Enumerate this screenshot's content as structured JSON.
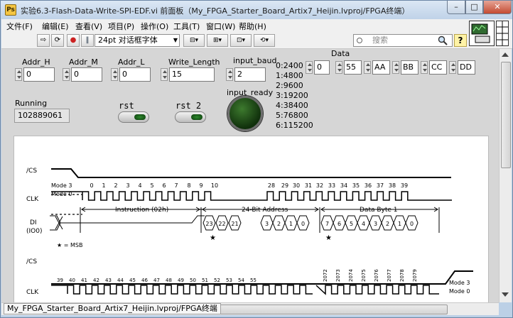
{
  "window": {
    "title": "实验6.3-Flash-Data-Write-SPI-EDF.vi 前面板（My_FPGA_Starter_Board_Artix7_Heijin.lvproj/FPGA终端）",
    "minimize": "–",
    "maximize": "□",
    "close": "✕"
  },
  "menu": [
    {
      "label": "文件(F)"
    },
    {
      "label": "编辑(E)"
    },
    {
      "label": "查看(V)"
    },
    {
      "label": "项目(P)"
    },
    {
      "label": "操作(O)"
    },
    {
      "label": "工具(T)"
    },
    {
      "label": "窗口(W)"
    },
    {
      "label": "帮助(H)"
    }
  ],
  "toolbar": {
    "font": "24pt 对话框字体",
    "search_placeholder": "搜索",
    "help": "?"
  },
  "controls": {
    "addr_h": {
      "label": "Addr_H",
      "value": "0"
    },
    "addr_m": {
      "label": "Addr_M",
      "value": "0"
    },
    "addr_l": {
      "label": "Addr_L",
      "value": "0"
    },
    "write_length": {
      "label": "Write_Length",
      "value": "15"
    },
    "input_baud": {
      "label": "input_baud",
      "value": "2"
    },
    "baud_options": [
      "0:2400",
      "1:4800",
      "2:9600",
      "3:19200",
      "4:38400",
      "5:76800",
      "6:115200"
    ],
    "data": {
      "label": "Data",
      "index": "0",
      "values": [
        "55",
        "AA",
        "BB",
        "CC",
        "DD"
      ]
    },
    "running": {
      "label": "Running",
      "value": "102889061"
    },
    "rst": {
      "label": "rst"
    },
    "rst2": {
      "label": "rst 2"
    },
    "input_ready": {
      "label": "input_ready"
    }
  },
  "timing": {
    "cs": "/CS",
    "clk": "CLK",
    "di": "DI",
    "io0": "(IO0)",
    "mode3": "Mode 3",
    "mode0": "Mode 0",
    "top_clk_nums": [
      "0",
      "1",
      "2",
      "3",
      "4",
      "5",
      "6",
      "7",
      "8",
      "9",
      "10",
      "28",
      "29",
      "30",
      "31",
      "32",
      "33",
      "34",
      "35",
      "36",
      "37",
      "38",
      "39"
    ],
    "instruction": "Instruction (02h)",
    "address": "24-Bit Address",
    "data_byte": "Data Byte 1",
    "addr_bits": [
      "23",
      "22",
      "21",
      "3",
      "2",
      "1",
      "0"
    ],
    "data_bits": [
      "7",
      "6",
      "5",
      "4",
      "3",
      "2",
      "1",
      "0"
    ],
    "msb_note": "★ = MSB",
    "bottom_clk_nums": [
      "39",
      "40",
      "41",
      "42",
      "43",
      "44",
      "45",
      "46",
      "47",
      "48",
      "49",
      "50",
      "51",
      "52",
      "53",
      "54",
      "55",
      "2072",
      "2073",
      "2074",
      "2075",
      "2076",
      "2077",
      "2078",
      "2079"
    ]
  },
  "status": {
    "text": "My_FPGA_Starter_Board_Artix7_Heijin.lvproj/FPGA终端"
  },
  "colors": {
    "led_on": "#2d8a2d",
    "led_off": "#10300c",
    "panel": "#d6d6d6"
  }
}
